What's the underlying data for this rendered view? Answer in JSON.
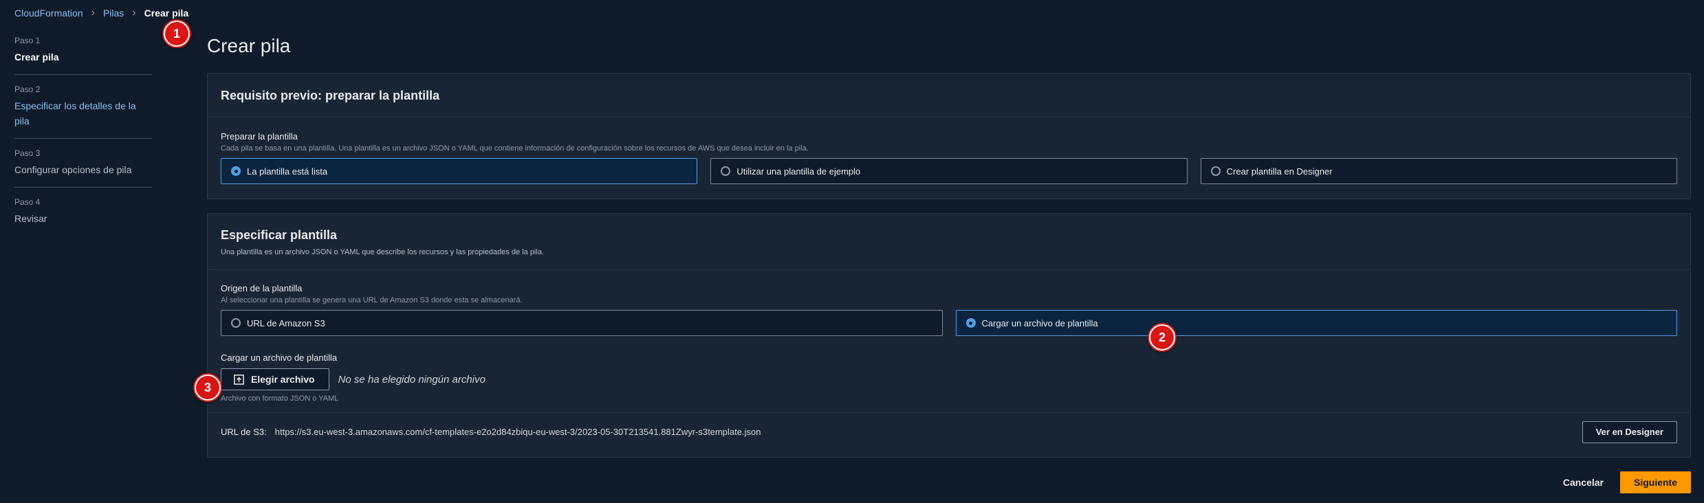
{
  "breadcrumb": {
    "root": "CloudFormation",
    "parent": "Pilas",
    "current": "Crear pila"
  },
  "markers": [
    "1",
    "2",
    "3"
  ],
  "steps": [
    {
      "number": "Paso 1",
      "title": "Crear pila"
    },
    {
      "number": "Paso 2",
      "title": "Especificar los detalles de la pila"
    },
    {
      "number": "Paso 3",
      "title": "Configurar opciones de pila"
    },
    {
      "number": "Paso 4",
      "title": "Revisar"
    }
  ],
  "page_title": "Crear pila",
  "prereq": {
    "heading": "Requisito previo: preparar la plantilla",
    "field_label": "Preparar la plantilla",
    "field_desc": "Cada pila se basa en una plantilla. Una plantilla es un archivo JSON o YAML que contiene información de configuración sobre los recursos de AWS que desea incluir en la pila.",
    "options": [
      {
        "label": "La plantilla está lista",
        "selected": true
      },
      {
        "label": "Utilizar una plantilla de ejemplo",
        "selected": false
      },
      {
        "label": "Crear plantilla en Designer",
        "selected": false
      }
    ]
  },
  "template": {
    "heading": "Especificar plantilla",
    "desc": "Una plantilla es un archivo JSON o YAML que describe los recursos y las propiedades de la pila.",
    "source_label": "Origen de la plantilla",
    "source_desc": "Al seleccionar una plantilla se genera una URL de Amazon S3 donde esta se almacenará.",
    "sources": [
      {
        "label": "URL de Amazon S3",
        "selected": false
      },
      {
        "label": "Cargar un archivo de plantilla",
        "selected": true
      }
    ],
    "upload_label": "Cargar un archivo de plantilla",
    "choose_button": "Elegir archivo",
    "no_file": "No se ha elegido ningún archivo",
    "hint": "Archivo con formato JSON o YAML",
    "s3_label": "URL de S3:",
    "s3_url": "https://s3.eu-west-3.amazonaws.com/cf-templates-e2o2d84zbiqu-eu-west-3/2023-05-30T213541.881Zwyr-s3template.json",
    "designer_button": "Ver en Designer"
  },
  "actions": {
    "cancel": "Cancelar",
    "next": "Siguiente"
  },
  "colors": {
    "accent": "#539fe5",
    "primary_button": "#ff9900",
    "marker": "#d91515",
    "background": "#0f1b2a"
  }
}
